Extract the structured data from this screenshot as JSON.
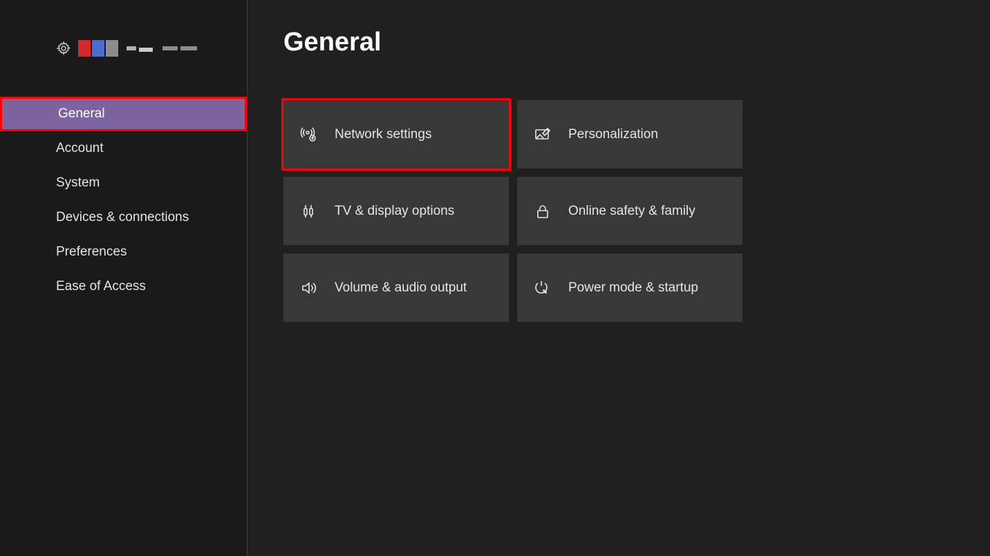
{
  "page": {
    "title": "General"
  },
  "sidebar": {
    "items": [
      {
        "label": "General",
        "selected": true,
        "highlight": true
      },
      {
        "label": "Account"
      },
      {
        "label": "System"
      },
      {
        "label": "Devices & connections"
      },
      {
        "label": "Preferences"
      },
      {
        "label": "Ease of Access"
      }
    ]
  },
  "tiles": [
    {
      "label": "Network settings",
      "icon": "network-icon",
      "highlight": true
    },
    {
      "label": "Personalization",
      "icon": "personalization-icon"
    },
    {
      "label": "TV & display options",
      "icon": "tv-display-icon"
    },
    {
      "label": "Online safety & family",
      "icon": "lock-icon"
    },
    {
      "label": "Volume & audio output",
      "icon": "volume-icon"
    },
    {
      "label": "Power mode & startup",
      "icon": "power-icon"
    }
  ]
}
